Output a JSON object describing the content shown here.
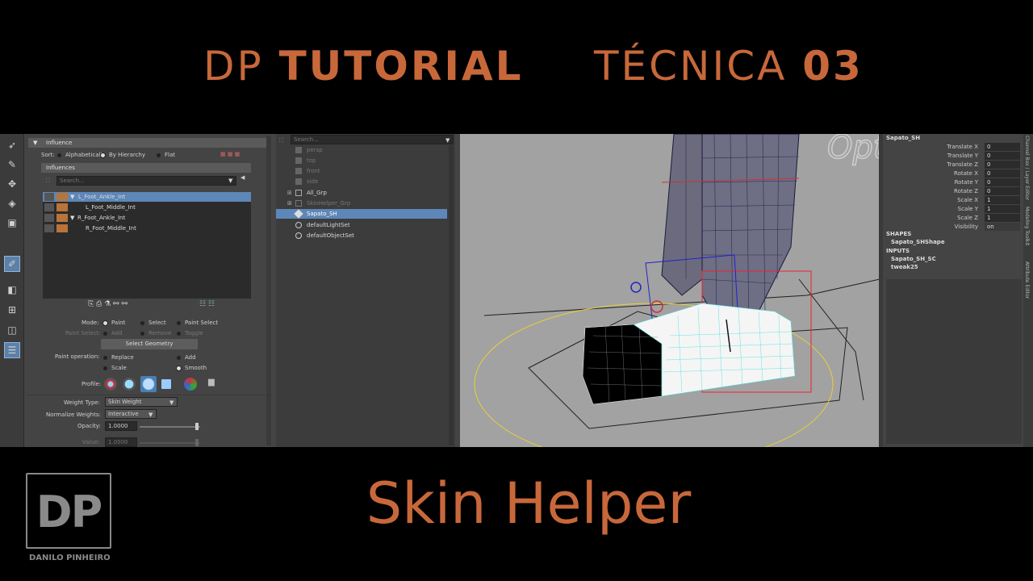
{
  "header": {
    "left_prefix": "DP",
    "left_bold": "TUTORIAL",
    "right_prefix": "TÉCNICA",
    "right_bold": "03"
  },
  "paint_panel": {
    "influence_section": "Influence",
    "sort_label": "Sort:",
    "sort_options": [
      "Alphabetically",
      "By Hierarchy",
      "Flat"
    ],
    "sort_selected": "By Hierarchy",
    "influences_label": "Influences",
    "search_placeholder": "Search...",
    "influences": [
      {
        "name": "L_Foot_Ankle_Int",
        "prefix": "▼",
        "selected": true
      },
      {
        "name": "L_Foot_Middle_Int",
        "prefix": "",
        "selected": false
      },
      {
        "name": "R_Foot_Ankle_Int",
        "prefix": "▼",
        "selected": false
      },
      {
        "name": "R_Foot_Middle_Int",
        "prefix": "",
        "selected": false
      }
    ],
    "mode_label": "Mode:",
    "mode_options": [
      "Paint",
      "Select",
      "Paint Select"
    ],
    "paint_select_label": "Paint Select:",
    "paint_select_options": [
      "Add",
      "Remove",
      "Toggle"
    ],
    "select_geometry": "Select Geometry",
    "paint_operation_label": "Paint operation:",
    "paint_operations": [
      "Replace",
      "Add",
      "Scale",
      "Smooth"
    ],
    "paint_operation_selected": "Smooth",
    "profile_label": "Profile:",
    "weight_type_label": "Weight Type:",
    "weight_type_value": "Skin Weight",
    "normalize_label": "Normalize Weights:",
    "normalize_value": "Interactive",
    "opacity_label": "Opacity:",
    "opacity_value": "1.0000",
    "value_label": "Value:",
    "value_value": "1.0000"
  },
  "outliner": {
    "search_placeholder": "Search...",
    "items": [
      {
        "label": "persp",
        "dim": true,
        "icon": "camera-icon"
      },
      {
        "label": "top",
        "dim": true,
        "icon": "camera-icon"
      },
      {
        "label": "front",
        "dim": true,
        "icon": "camera-icon"
      },
      {
        "label": "side",
        "dim": true,
        "icon": "camera-icon"
      },
      {
        "label": "All_Grp",
        "dim": false,
        "icon": "group-icon"
      },
      {
        "label": "SkinHelper_Grp",
        "dim": true,
        "icon": "group-icon"
      },
      {
        "label": "Sapato_SH",
        "dim": false,
        "icon": "mesh-icon",
        "selected": true
      },
      {
        "label": "defaultLightSet",
        "dim": false,
        "icon": "set-icon"
      },
      {
        "label": "defaultObjectSet",
        "dim": false,
        "icon": "set-icon"
      }
    ]
  },
  "channel_box": {
    "object": "Sapato_SH",
    "channels": [
      {
        "label": "Translate X",
        "value": "0"
      },
      {
        "label": "Translate Y",
        "value": "0"
      },
      {
        "label": "Translate Z",
        "value": "0"
      },
      {
        "label": "Rotate X",
        "value": "0"
      },
      {
        "label": "Rotate Y",
        "value": "0"
      },
      {
        "label": "Rotate Z",
        "value": "0"
      },
      {
        "label": "Scale X",
        "value": "1"
      },
      {
        "label": "Scale Y",
        "value": "1"
      },
      {
        "label": "Scale Z",
        "value": "1"
      },
      {
        "label": "Visibility",
        "value": "on"
      }
    ],
    "shapes_label": "SHAPES",
    "shape": "Sapato_SHShape",
    "inputs_label": "INPUTS",
    "inputs": [
      "Sapato_SH_SC",
      "tweak25"
    ],
    "side_tabs": [
      "Channel Box / Layer Editor",
      "Modeling Toolkit",
      "Attribute Editor"
    ]
  },
  "viewport": {
    "watermark": "Opt"
  },
  "title": "Skin Helper",
  "logo": {
    "letters": "DP",
    "name": "DANILO PINHEIRO"
  },
  "colors": {
    "accent": "#c8683a",
    "selection": "#5d87b8",
    "lock": "#b8743a"
  }
}
